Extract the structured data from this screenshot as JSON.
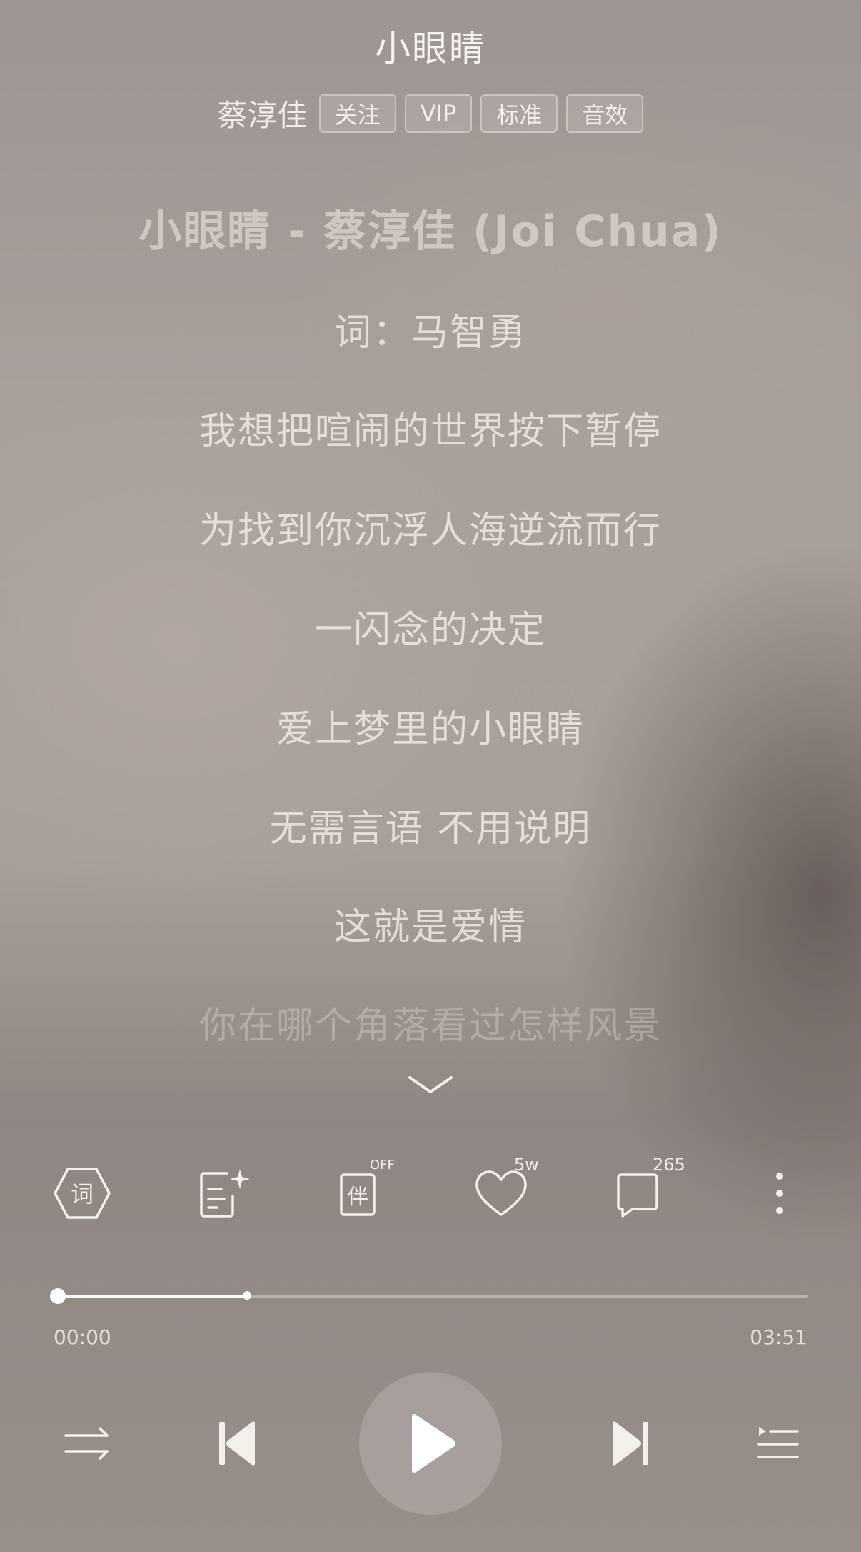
{
  "header": {
    "song_title": "小眼睛",
    "artist": "蔡淳佳",
    "chips": [
      "关注",
      "VIP",
      "标准",
      "音效"
    ]
  },
  "lyrics": [
    "小眼睛 - 蔡淳佳 (Joi Chua)",
    "词：马智勇",
    "我想把喧闹的世界按下暂停",
    "为找到你沉浮人海逆流而行",
    "一闪念的决定",
    "爱上梦里的小眼睛",
    "无需言语 不用说明",
    "这就是爱情",
    "你在哪个角落看过怎样风景"
  ],
  "actions": {
    "lyric_icon_text": "词",
    "accompaniment_icon_text": "伴",
    "accompaniment_state": "OFF",
    "like_count": "5w",
    "comment_count": "265"
  },
  "playback": {
    "current_time": "00:00",
    "total_time": "03:51",
    "progress_fraction": 0.01,
    "buffered_fraction": 0.26
  },
  "icons": {
    "lyric": "lyric-hexagon-icon",
    "edit_lyrics": "edit-lyrics-icon",
    "accompaniment": "accompaniment-icon",
    "like": "heart-icon",
    "comment": "comment-icon",
    "more": "more-vertical-icon",
    "collapse": "chevron-down-icon",
    "play_mode": "shuffle-icon",
    "previous": "previous-icon",
    "play": "play-icon",
    "next": "next-icon",
    "playlist": "playlist-icon"
  }
}
